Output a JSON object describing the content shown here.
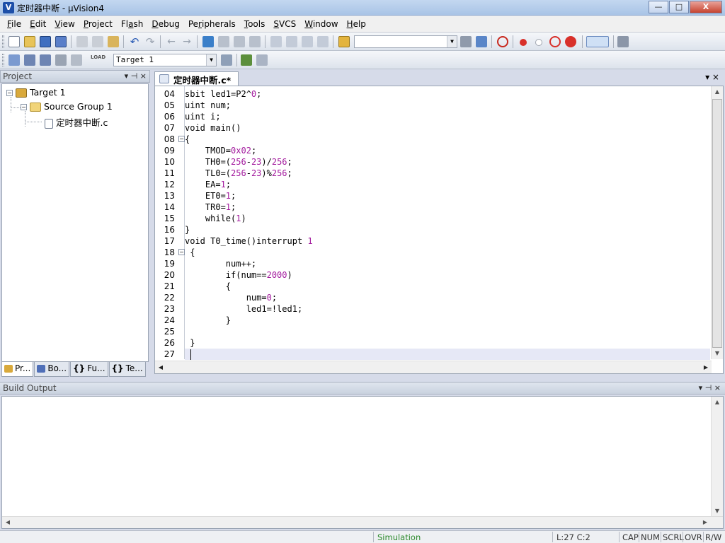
{
  "window": {
    "title": "定时器中断 - µVision4",
    "logo": "V",
    "minimize": "—",
    "maximize": "□",
    "close": "X"
  },
  "menu": [
    {
      "pre": "",
      "ul": "F",
      "post": "ile"
    },
    {
      "pre": "",
      "ul": "E",
      "post": "dit"
    },
    {
      "pre": "",
      "ul": "V",
      "post": "iew"
    },
    {
      "pre": "",
      "ul": "P",
      "post": "roject"
    },
    {
      "pre": "Fl",
      "ul": "a",
      "post": "sh"
    },
    {
      "pre": "",
      "ul": "D",
      "post": "ebug"
    },
    {
      "pre": "Pe",
      "ul": "r",
      "post": "ipherals"
    },
    {
      "pre": "",
      "ul": "T",
      "post": "ools"
    },
    {
      "pre": "",
      "ul": "S",
      "post": "VCS"
    },
    {
      "pre": "",
      "ul": "W",
      "post": "indow"
    },
    {
      "pre": "",
      "ul": "H",
      "post": "elp"
    }
  ],
  "toolbar": {
    "find_combo_value": "",
    "target_combo_value": "Target 1",
    "load_label": "LOAD"
  },
  "colors": {
    "breakpoint_red": "#d8302a",
    "accent_blue": "#2a5bb5"
  },
  "project": {
    "header": "Project",
    "ctrl_pin": "▾ ⊣ ×",
    "tree": [
      {
        "label": "Target 1",
        "level": 0,
        "expander": "−",
        "icon": "target-icon"
      },
      {
        "label": "Source Group 1",
        "level": 1,
        "expander": "−",
        "icon": "folder-icon"
      },
      {
        "label": "定时器中断.c",
        "level": 2,
        "expander": "",
        "icon": "c-file-icon"
      }
    ],
    "tabs": [
      {
        "label": "Pr...",
        "icon": "project-tab-icon"
      },
      {
        "label": "Bo...",
        "icon": "books-tab-icon"
      },
      {
        "label": "Fu...",
        "icon": "functions-tab-icon"
      },
      {
        "label": "Te...",
        "icon": "templates-tab-icon"
      }
    ],
    "func_glyph": "{}",
    "tmpl_glyph": "{}"
  },
  "editor": {
    "tab_label": "定时器中断.c*",
    "ctrls": "▾  ×",
    "lines": [
      {
        "n": "04",
        "code": [
          [
            "sbit led1=P2^",
            ""
          ],
          [
            "0",
            "num"
          ],
          [
            ";",
            ""
          ]
        ]
      },
      {
        "n": "05",
        "code": [
          [
            "uint num;",
            ""
          ]
        ]
      },
      {
        "n": "06",
        "code": [
          [
            "uint i;",
            ""
          ]
        ]
      },
      {
        "n": "07",
        "code": [
          [
            "void main()",
            ""
          ]
        ]
      },
      {
        "n": "08",
        "code": [
          [
            "{",
            ""
          ]
        ],
        "fold": "−"
      },
      {
        "n": "09",
        "code": [
          [
            "    TMOD=",
            ""
          ],
          [
            "0x02",
            "num"
          ],
          [
            ";",
            ""
          ]
        ]
      },
      {
        "n": "10",
        "code": [
          [
            "    TH0=(",
            ""
          ],
          [
            "256",
            "num"
          ],
          [
            "-",
            ""
          ],
          [
            "23",
            "num"
          ],
          [
            ")/",
            ""
          ],
          [
            "256",
            "num"
          ],
          [
            ";",
            ""
          ]
        ]
      },
      {
        "n": "11",
        "code": [
          [
            "    TL0=(",
            ""
          ],
          [
            "256",
            "num"
          ],
          [
            "-",
            ""
          ],
          [
            "23",
            "num"
          ],
          [
            ")%",
            ""
          ],
          [
            "256",
            "num"
          ],
          [
            ";",
            ""
          ]
        ]
      },
      {
        "n": "12",
        "code": [
          [
            "    EA=",
            ""
          ],
          [
            "1",
            "num"
          ],
          [
            ";",
            ""
          ]
        ]
      },
      {
        "n": "13",
        "code": [
          [
            "    ET0=",
            ""
          ],
          [
            "1",
            "num"
          ],
          [
            ";",
            ""
          ]
        ]
      },
      {
        "n": "14",
        "code": [
          [
            "    TR0=",
            ""
          ],
          [
            "1",
            "num"
          ],
          [
            ";",
            ""
          ]
        ]
      },
      {
        "n": "15",
        "code": [
          [
            "    while(",
            ""
          ],
          [
            "1",
            "num"
          ],
          [
            ")",
            ""
          ]
        ]
      },
      {
        "n": "16",
        "code": [
          [
            "}",
            ""
          ]
        ]
      },
      {
        "n": "17",
        "code": [
          [
            "void T0_time()interrupt ",
            ""
          ],
          [
            "1",
            "num"
          ]
        ]
      },
      {
        "n": "18",
        "code": [
          [
            " {",
            ""
          ]
        ],
        "fold": "−"
      },
      {
        "n": "19",
        "code": [
          [
            "        num++;",
            ""
          ]
        ]
      },
      {
        "n": "20",
        "code": [
          [
            "        if(num==",
            ""
          ],
          [
            "2000",
            "num"
          ],
          [
            ")",
            ""
          ]
        ]
      },
      {
        "n": "21",
        "code": [
          [
            "        {",
            ""
          ]
        ]
      },
      {
        "n": "22",
        "code": [
          [
            "            num=",
            ""
          ],
          [
            "0",
            "num"
          ],
          [
            ";",
            ""
          ]
        ]
      },
      {
        "n": "23",
        "code": [
          [
            "            led1=!led1;",
            ""
          ]
        ]
      },
      {
        "n": "24",
        "code": [
          [
            "        }",
            ""
          ]
        ]
      },
      {
        "n": "25",
        "code": [
          [
            "",
            ""
          ]
        ]
      },
      {
        "n": "26",
        "code": [
          [
            " }",
            ""
          ]
        ]
      },
      {
        "n": "27",
        "code": [
          [
            "",
            ""
          ]
        ],
        "current": true
      }
    ]
  },
  "build_output": {
    "header": "Build Output",
    "ctrls": "▾ ⊣ ×"
  },
  "status": {
    "mode": "Simulation",
    "position": "L:27 C:2",
    "cap": "CAP",
    "num": "NUM",
    "scrl": "SCRL",
    "ovr": "OVR",
    "rw": "R/W"
  }
}
